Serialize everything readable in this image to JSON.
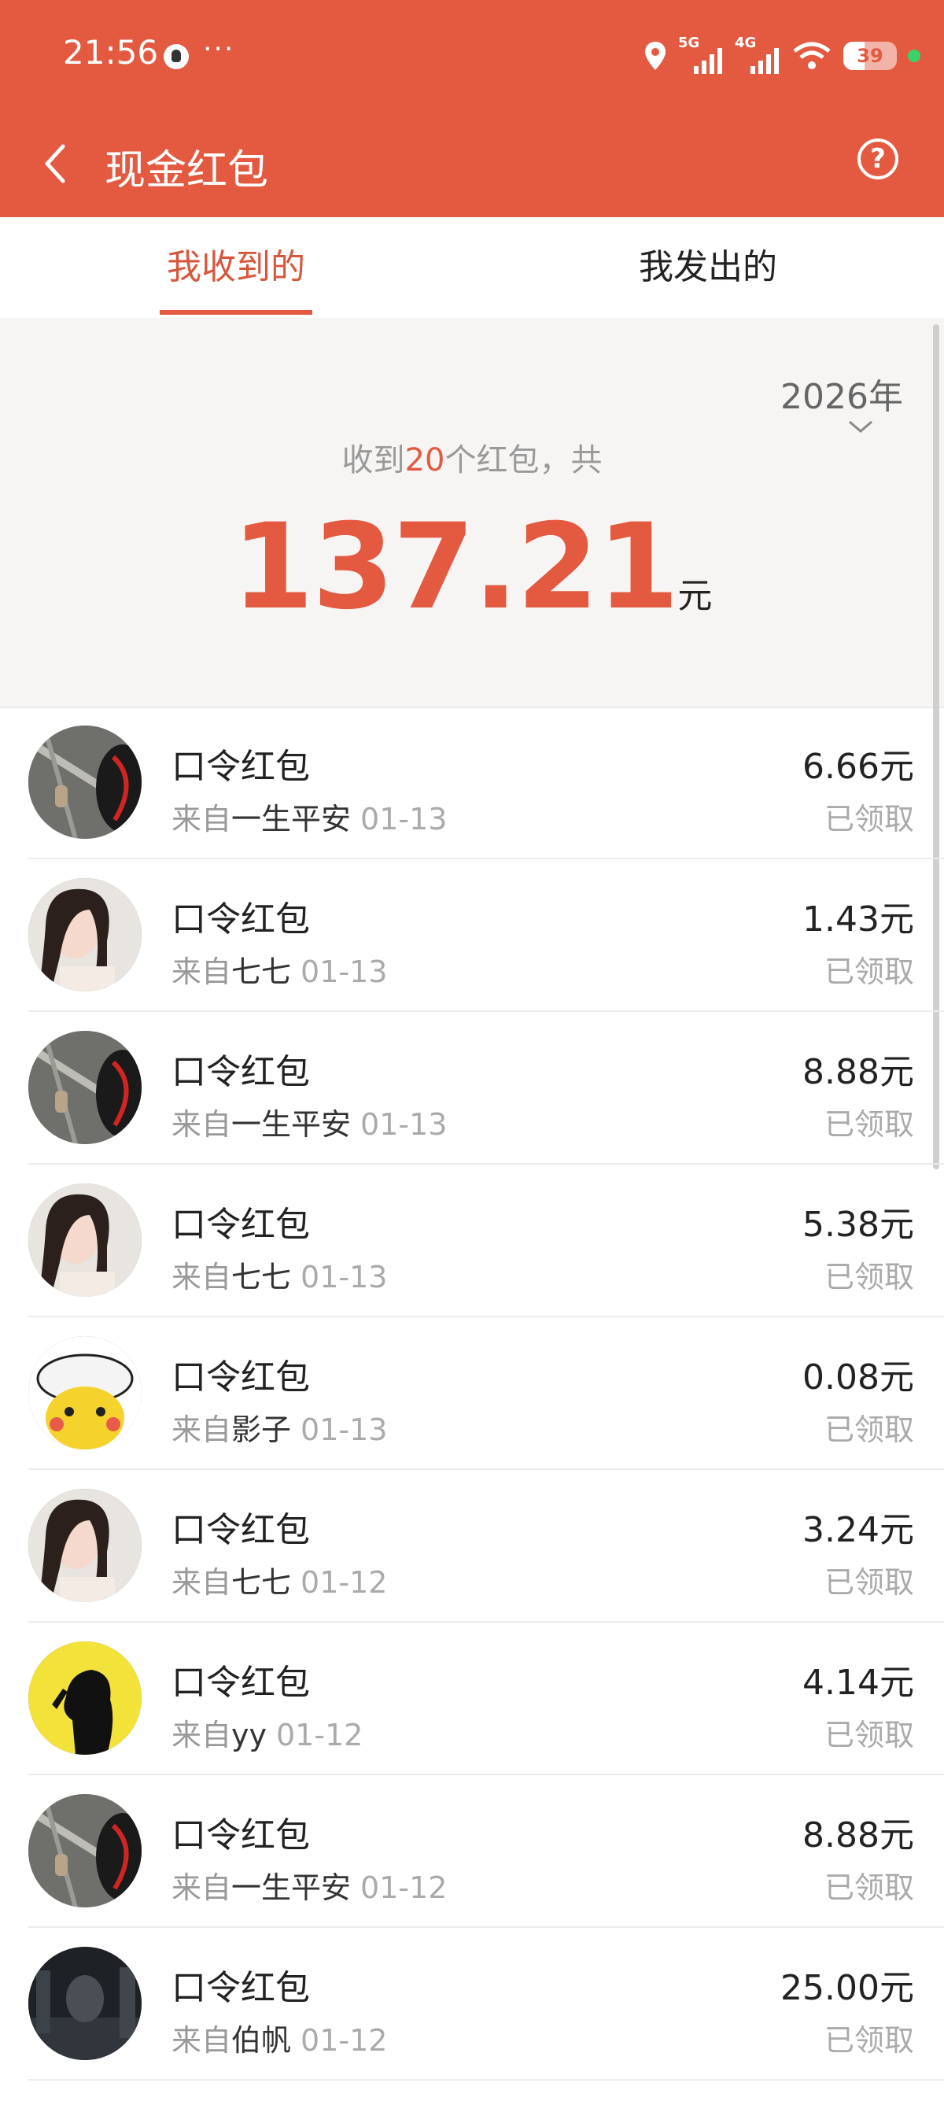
{
  "status_bar": {
    "time": "21:56",
    "extra": "···",
    "signal1_label": "5G",
    "signal2_label": "4G",
    "battery_level": "39",
    "battery_fraction": 0.39
  },
  "header": {
    "title": "现金红包",
    "help_label": "?"
  },
  "tabs": [
    {
      "label": "我收到的",
      "active": true
    },
    {
      "label": "我发出的",
      "active": false
    }
  ],
  "summary": {
    "year": "2026年",
    "count_prefix": "收到",
    "count": "20",
    "count_suffix": "个红包，共",
    "total": "137.21",
    "unit": "元"
  },
  "list": [
    {
      "title": "口令红包",
      "from": "来自",
      "sender": "一生平安",
      "date": "01-13",
      "amount": "6.66元",
      "status": "已领取",
      "avatar": "cat"
    },
    {
      "title": "口令红包",
      "from": "来自",
      "sender": "七七",
      "date": "01-13",
      "amount": "1.43元",
      "status": "已领取",
      "avatar": "girl"
    },
    {
      "title": "口令红包",
      "from": "来自",
      "sender": "一生平安",
      "date": "01-13",
      "amount": "8.88元",
      "status": "已领取",
      "avatar": "cat"
    },
    {
      "title": "口令红包",
      "from": "来自",
      "sender": "七七",
      "date": "01-13",
      "amount": "5.38元",
      "status": "已领取",
      "avatar": "girl"
    },
    {
      "title": "口令红包",
      "from": "来自",
      "sender": "影子",
      "date": "01-13",
      "amount": "0.08元",
      "status": "已领取",
      "avatar": "pikachu"
    },
    {
      "title": "口令红包",
      "from": "来自",
      "sender": "七七",
      "date": "01-12",
      "amount": "3.24元",
      "status": "已领取",
      "avatar": "girl"
    },
    {
      "title": "口令红包",
      "from": "来自",
      "sender": "yy",
      "date": "01-12",
      "amount": "4.14元",
      "status": "已领取",
      "avatar": "silhouette"
    },
    {
      "title": "口令红包",
      "from": "来自",
      "sender": "一生平安",
      "date": "01-12",
      "amount": "8.88元",
      "status": "已领取",
      "avatar": "cat"
    },
    {
      "title": "口令红包",
      "from": "来自",
      "sender": "伯帆",
      "date": "01-12",
      "amount": "25.00元",
      "status": "已领取",
      "avatar": "dark"
    }
  ]
}
